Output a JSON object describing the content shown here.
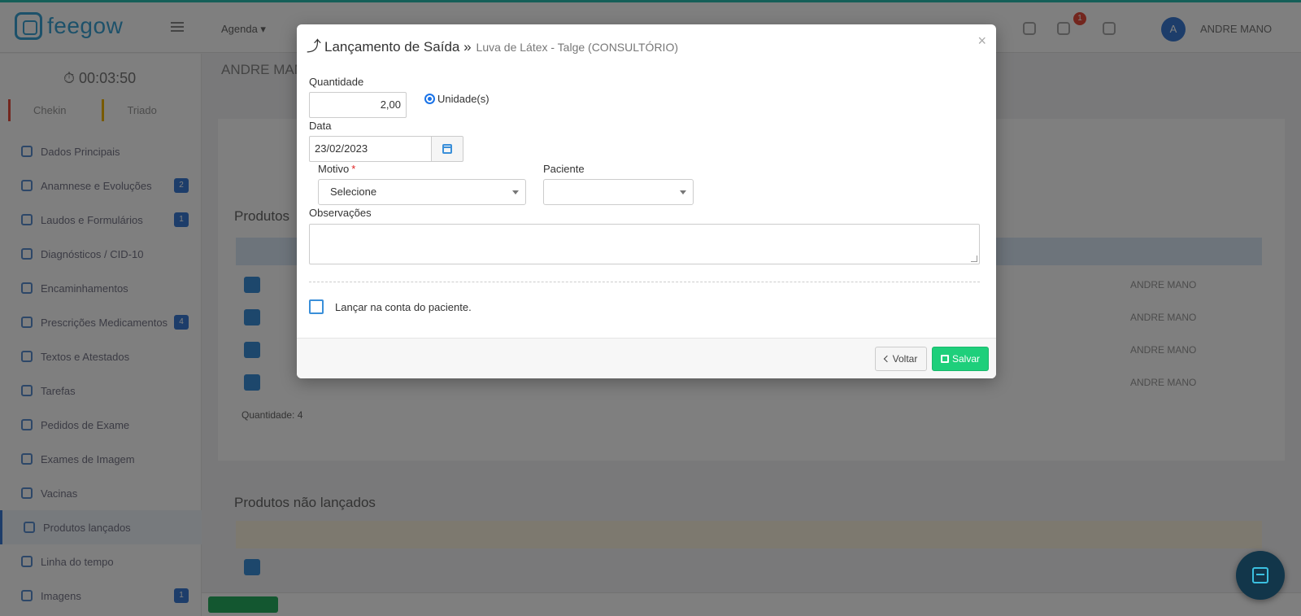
{
  "background": {
    "brand": "feegow",
    "nav_agenda": "Agenda ▾",
    "notification_count": "1",
    "avatar_initial": "A",
    "user_name": "ANDRE MANO",
    "timer": "00:03:50",
    "status_tabs": [
      "Chekin",
      "Triado"
    ],
    "patient_title": "ANDRE MANO",
    "sidebar_items": [
      {
        "label": "Dados Principais",
        "badge": ""
      },
      {
        "label": "Anamnese e Evoluções",
        "badge": "2"
      },
      {
        "label": "Laudos e Formulários",
        "badge": "1"
      },
      {
        "label": "Diagnósticos / CID-10",
        "badge": ""
      },
      {
        "label": "Encaminhamentos",
        "badge": ""
      },
      {
        "label": "Prescrições Medicamentos",
        "badge": "4"
      },
      {
        "label": "Textos e Atestados",
        "badge": ""
      },
      {
        "label": "Tarefas",
        "badge": ""
      },
      {
        "label": "Pedidos de Exame",
        "badge": ""
      },
      {
        "label": "Exames de Imagem",
        "badge": ""
      },
      {
        "label": "Vacinas",
        "badge": ""
      },
      {
        "label": "Produtos lançados",
        "badge": ""
      },
      {
        "label": "Linha do tempo",
        "badge": ""
      },
      {
        "label": "Imagens",
        "badge": "1"
      }
    ],
    "produtos_title": "Produtos",
    "produtos_nao_lancados": "Produtos não lançados",
    "quantidade": "Quantidade: 4",
    "row_user": "ANDRE MANO"
  },
  "modal": {
    "title": "Lançamento de Saída »",
    "subtitle": "Luva de Látex - Talge (CONSULTÓRIO)",
    "close": "×",
    "quantidade_label": "Quantidade",
    "quantidade_value": "2,00",
    "unidade_label": "Unidade(s)",
    "data_label": "Data",
    "data_value": "23/02/2023",
    "motivo_label": "Motivo",
    "motivo_required": "*",
    "motivo_value": "Selecione",
    "paciente_label": "Paciente",
    "paciente_value": "",
    "observacoes_label": "Observações",
    "lancar_label": "Lançar na conta do paciente.",
    "voltar": "Voltar",
    "salvar": "Salvar"
  },
  "icons": [
    "arrow-up-icon",
    "calendar-icon",
    "chevron-left-icon",
    "save-icon",
    "chat-icon"
  ],
  "colors": {
    "primary": "#3a8fd9",
    "save": "#1ecf7b",
    "required": "#e02424"
  }
}
